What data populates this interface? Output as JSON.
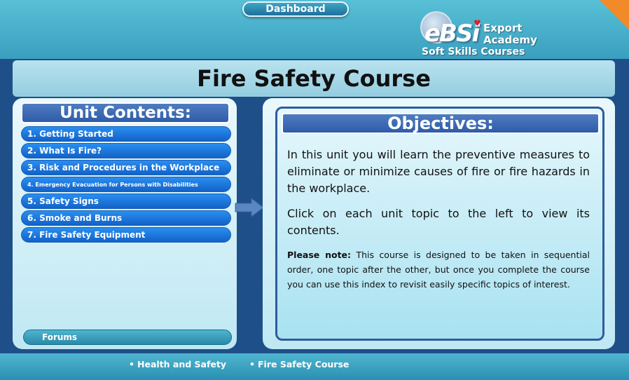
{
  "header": {
    "dashboard_label": "Dashboard",
    "logo": {
      "brand": "eBSi",
      "line1": "Export",
      "line2": "Academy",
      "subtitle": "Soft Skills Courses"
    }
  },
  "course_title": "Fire Safety Course",
  "unit_contents": {
    "heading": "Unit Contents:",
    "items": [
      {
        "label": "1. Getting Started"
      },
      {
        "label": "2. What Is Fire?"
      },
      {
        "label": "3. Risk and Procedures in the Workplace"
      },
      {
        "label": "4. Emergency Evacuation for Persons with Disabilities"
      },
      {
        "label": "5. Safety Signs"
      },
      {
        "label": "6. Smoke and Burns"
      },
      {
        "label": "7. Fire Safety Equipment"
      }
    ],
    "forums_label": "Forums"
  },
  "objectives": {
    "heading": "Objectives:",
    "para1": "In this unit you will learn the preventive measures to eliminate or minimize causes of fire or fire hazards in the workplace.",
    "para2": "Click on each unit topic to the left to view its contents.",
    "note_label": "Please note:",
    "note_text": " This course is designed to be taken in sequential order, one topic after the other, but once you complete the course you can use this index to revisit easily specific topics of interest."
  },
  "footer": {
    "crumbs": [
      {
        "label": "Health and Safety"
      },
      {
        "label": "Fire Safety Course"
      }
    ]
  },
  "colors": {
    "accent_orange": "#f28a2a",
    "nav_blue": "#1f7ae0",
    "heading_blue": "#3a68b4",
    "page_bg": "#1e4f88"
  }
}
